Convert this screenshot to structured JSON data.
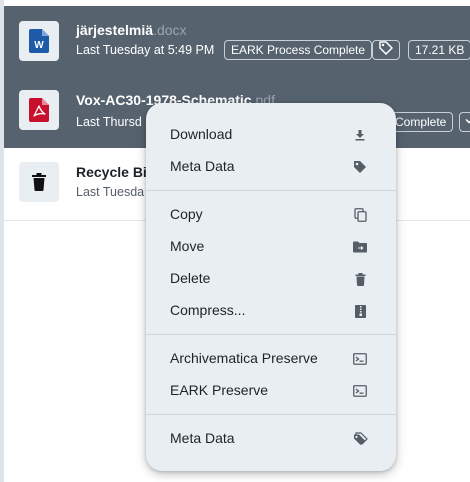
{
  "files": [
    {
      "name": "järjestelmiä",
      "ext": ".docx",
      "date": "Last Tuesday at 5:49 PM",
      "status": "EARK Process Complete",
      "size": "17.21 KB",
      "icon": "word-doc-icon"
    },
    {
      "name": "Vox-AC30-1978-Schematic",
      "ext": ".pdf",
      "date": "Last Thursd",
      "status": "Complete",
      "icon": "pdf-icon"
    },
    {
      "name": "Recycle Bin",
      "date": "Last Tuesda",
      "icon": "trash-icon"
    }
  ],
  "menu": {
    "download": "Download",
    "meta_data_top": "Meta Data",
    "copy": "Copy",
    "move": "Move",
    "delete": "Delete",
    "compress": "Compress...",
    "archivematica_preserve": "Archivematica Preserve",
    "eark_preserve": "EARK Preserve",
    "meta_data_bottom": "Meta Data"
  },
  "colors": {
    "selected_row": "#56636f",
    "menu_bg": "#e9eef3",
    "pdf_red": "#c8102e",
    "word_blue": "#1e5aa8"
  }
}
